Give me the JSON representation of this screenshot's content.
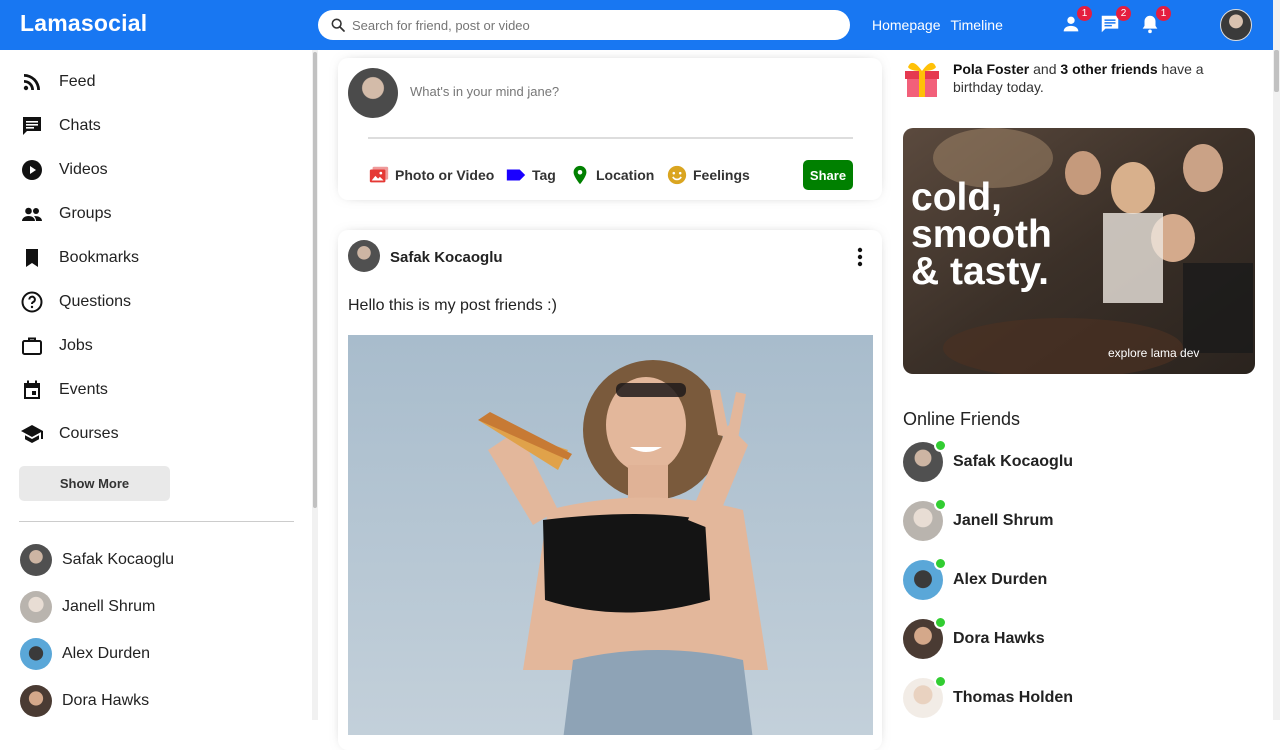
{
  "topbar": {
    "logo": "Lamasocial",
    "search_placeholder": "Search for friend, post or video",
    "links": [
      "Homepage",
      "Timeline"
    ],
    "notifications": [
      {
        "icon": "person-icon",
        "count": "1"
      },
      {
        "icon": "chat-icon",
        "count": "2"
      },
      {
        "icon": "bell-icon",
        "count": "1"
      }
    ],
    "brand_color": "#1877f2"
  },
  "sidebar": {
    "items": [
      {
        "icon": "rss-feed-icon",
        "label": "Feed"
      },
      {
        "icon": "chat-icon",
        "label": "Chats"
      },
      {
        "icon": "play-circle-icon",
        "label": "Videos"
      },
      {
        "icon": "group-icon",
        "label": "Groups"
      },
      {
        "icon": "bookmark-icon",
        "label": "Bookmarks"
      },
      {
        "icon": "help-circle-icon",
        "label": "Questions"
      },
      {
        "icon": "work-outline-icon",
        "label": "Jobs"
      },
      {
        "icon": "event-icon",
        "label": "Events"
      },
      {
        "icon": "school-icon",
        "label": "Courses"
      }
    ],
    "show_more": "Show More",
    "friends": [
      "Safak Kocaoglu",
      "Janell Shrum",
      "Alex Durden",
      "Dora Hawks"
    ]
  },
  "share": {
    "placeholder": "What's in your mind jane?",
    "options": [
      {
        "icon": "photo-icon",
        "label": "Photo or Video",
        "color": "#e53935"
      },
      {
        "icon": "label-icon",
        "label": "Tag",
        "color": "#1a00ff"
      },
      {
        "icon": "location-icon",
        "label": "Location",
        "color": "#008000"
      },
      {
        "icon": "emoji-icon",
        "label": "Feelings",
        "color": "#daa520"
      }
    ],
    "button": "Share"
  },
  "post": {
    "username": "Safak Kocaoglu",
    "text": "Hello this is my post friends :)"
  },
  "rightbar": {
    "birthday_name": "Pola Foster",
    "birthday_and": " and ",
    "birthday_others": "3 other friends",
    "birthday_suffix": " have a birthday today.",
    "ad_text": [
      "cold,",
      "smooth",
      "& tasty."
    ],
    "ad_caption": "explore lama dev",
    "online_title": "Online Friends",
    "online_friends": [
      "Safak Kocaoglu",
      "Janell Shrum",
      "Alex Durden",
      "Dora Hawks",
      "Thomas Holden"
    ],
    "online_color": "#32cd32"
  }
}
